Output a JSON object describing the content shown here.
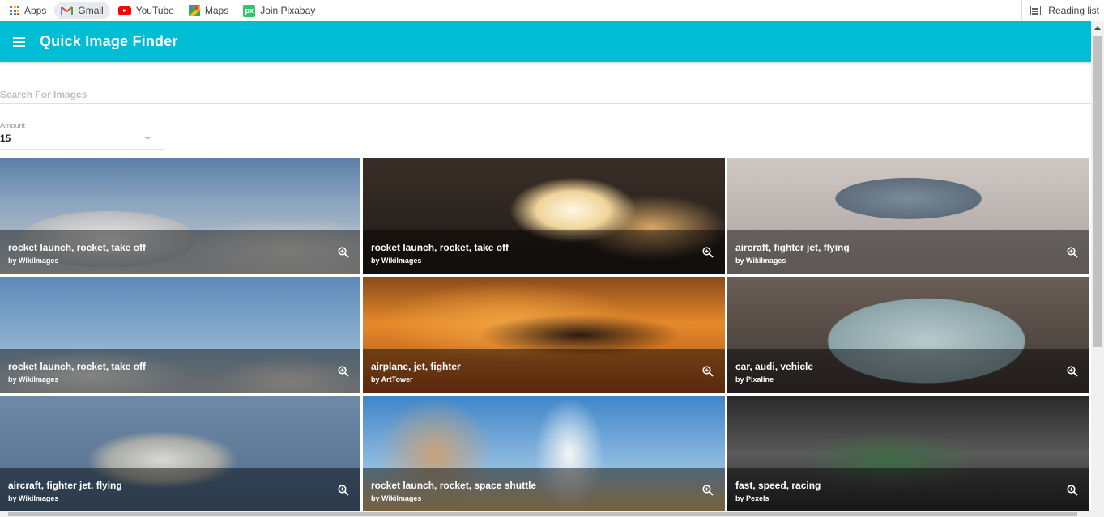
{
  "bookmarks": [
    {
      "label": "Apps",
      "icon": "apps-grid-icon"
    },
    {
      "label": "Gmail",
      "icon": "gmail-icon"
    },
    {
      "label": "YouTube",
      "icon": "youtube-icon"
    },
    {
      "label": "Maps",
      "icon": "maps-icon"
    },
    {
      "label": "Join Pixabay",
      "icon": "pixabay-icon"
    }
  ],
  "reading_list": {
    "label": "Reading list",
    "icon": "reading-list-icon"
  },
  "appbar": {
    "title": "Quick Image Finder",
    "color": "#00bcd4",
    "menu_icon": "hamburger-menu-icon"
  },
  "search": {
    "placeholder": "Search For Images",
    "value": ""
  },
  "amount": {
    "label": "Amount",
    "value": "15"
  },
  "results": [
    {
      "tags": "rocket launch, rocket, take off",
      "by": "by WikiImages"
    },
    {
      "tags": "rocket launch, rocket, take off",
      "by": "by WikiImages"
    },
    {
      "tags": "aircraft, fighter jet, flying",
      "by": "by WikiImages"
    },
    {
      "tags": "rocket launch, rocket, take off",
      "by": "by WikiImages"
    },
    {
      "tags": "airplane, jet, fighter",
      "by": "by ArtTower"
    },
    {
      "tags": "car, audi, vehicle",
      "by": "by Pixaline"
    },
    {
      "tags": "aircraft, fighter jet, flying",
      "by": "by WikiImages"
    },
    {
      "tags": "rocket launch, rocket, space shuttle",
      "by": "by WikiImages"
    },
    {
      "tags": "fast, speed, racing",
      "by": "by Pexels"
    }
  ]
}
